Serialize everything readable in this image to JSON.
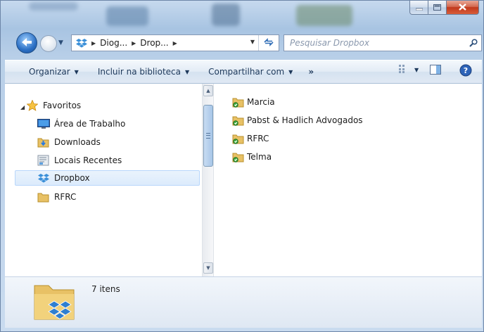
{
  "window": {
    "controls": {
      "minimize_icon": "minimize-icon",
      "maximize_icon": "maximize-icon",
      "close_icon": "close-icon"
    }
  },
  "nav": {
    "breadcrumbs": [
      "Diog...",
      "Drop..."
    ],
    "search_placeholder": "Pesquisar Dropbox"
  },
  "toolbar": {
    "organize": "Organizar",
    "include_library": "Incluir na biblioteca",
    "share_with": "Compartilhar com",
    "more": "»"
  },
  "sidebar": {
    "items": [
      {
        "label": "Favoritos",
        "icon": "star-icon"
      },
      {
        "label": "Área de Trabalho",
        "icon": "desktop-icon"
      },
      {
        "label": "Downloads",
        "icon": "downloads-folder-icon"
      },
      {
        "label": "Locais Recentes",
        "icon": "recent-places-icon"
      },
      {
        "label": "Dropbox",
        "icon": "dropbox-icon",
        "selected": true
      },
      {
        "label": "RFRC",
        "icon": "folder-icon"
      }
    ]
  },
  "files": [
    {
      "name": "Marcia",
      "icon": "shared-folder-icon"
    },
    {
      "name": "Pabst & Hadlich Advogados",
      "icon": "shared-folder-icon"
    },
    {
      "name": "RFRC",
      "icon": "shared-folder-icon"
    },
    {
      "name": "Telma",
      "icon": "shared-folder-icon"
    }
  ],
  "details": {
    "item_count": "7 itens"
  },
  "colors": {
    "selection": "#dcebfc",
    "accent": "#1e395b",
    "close": "#c1381c"
  }
}
